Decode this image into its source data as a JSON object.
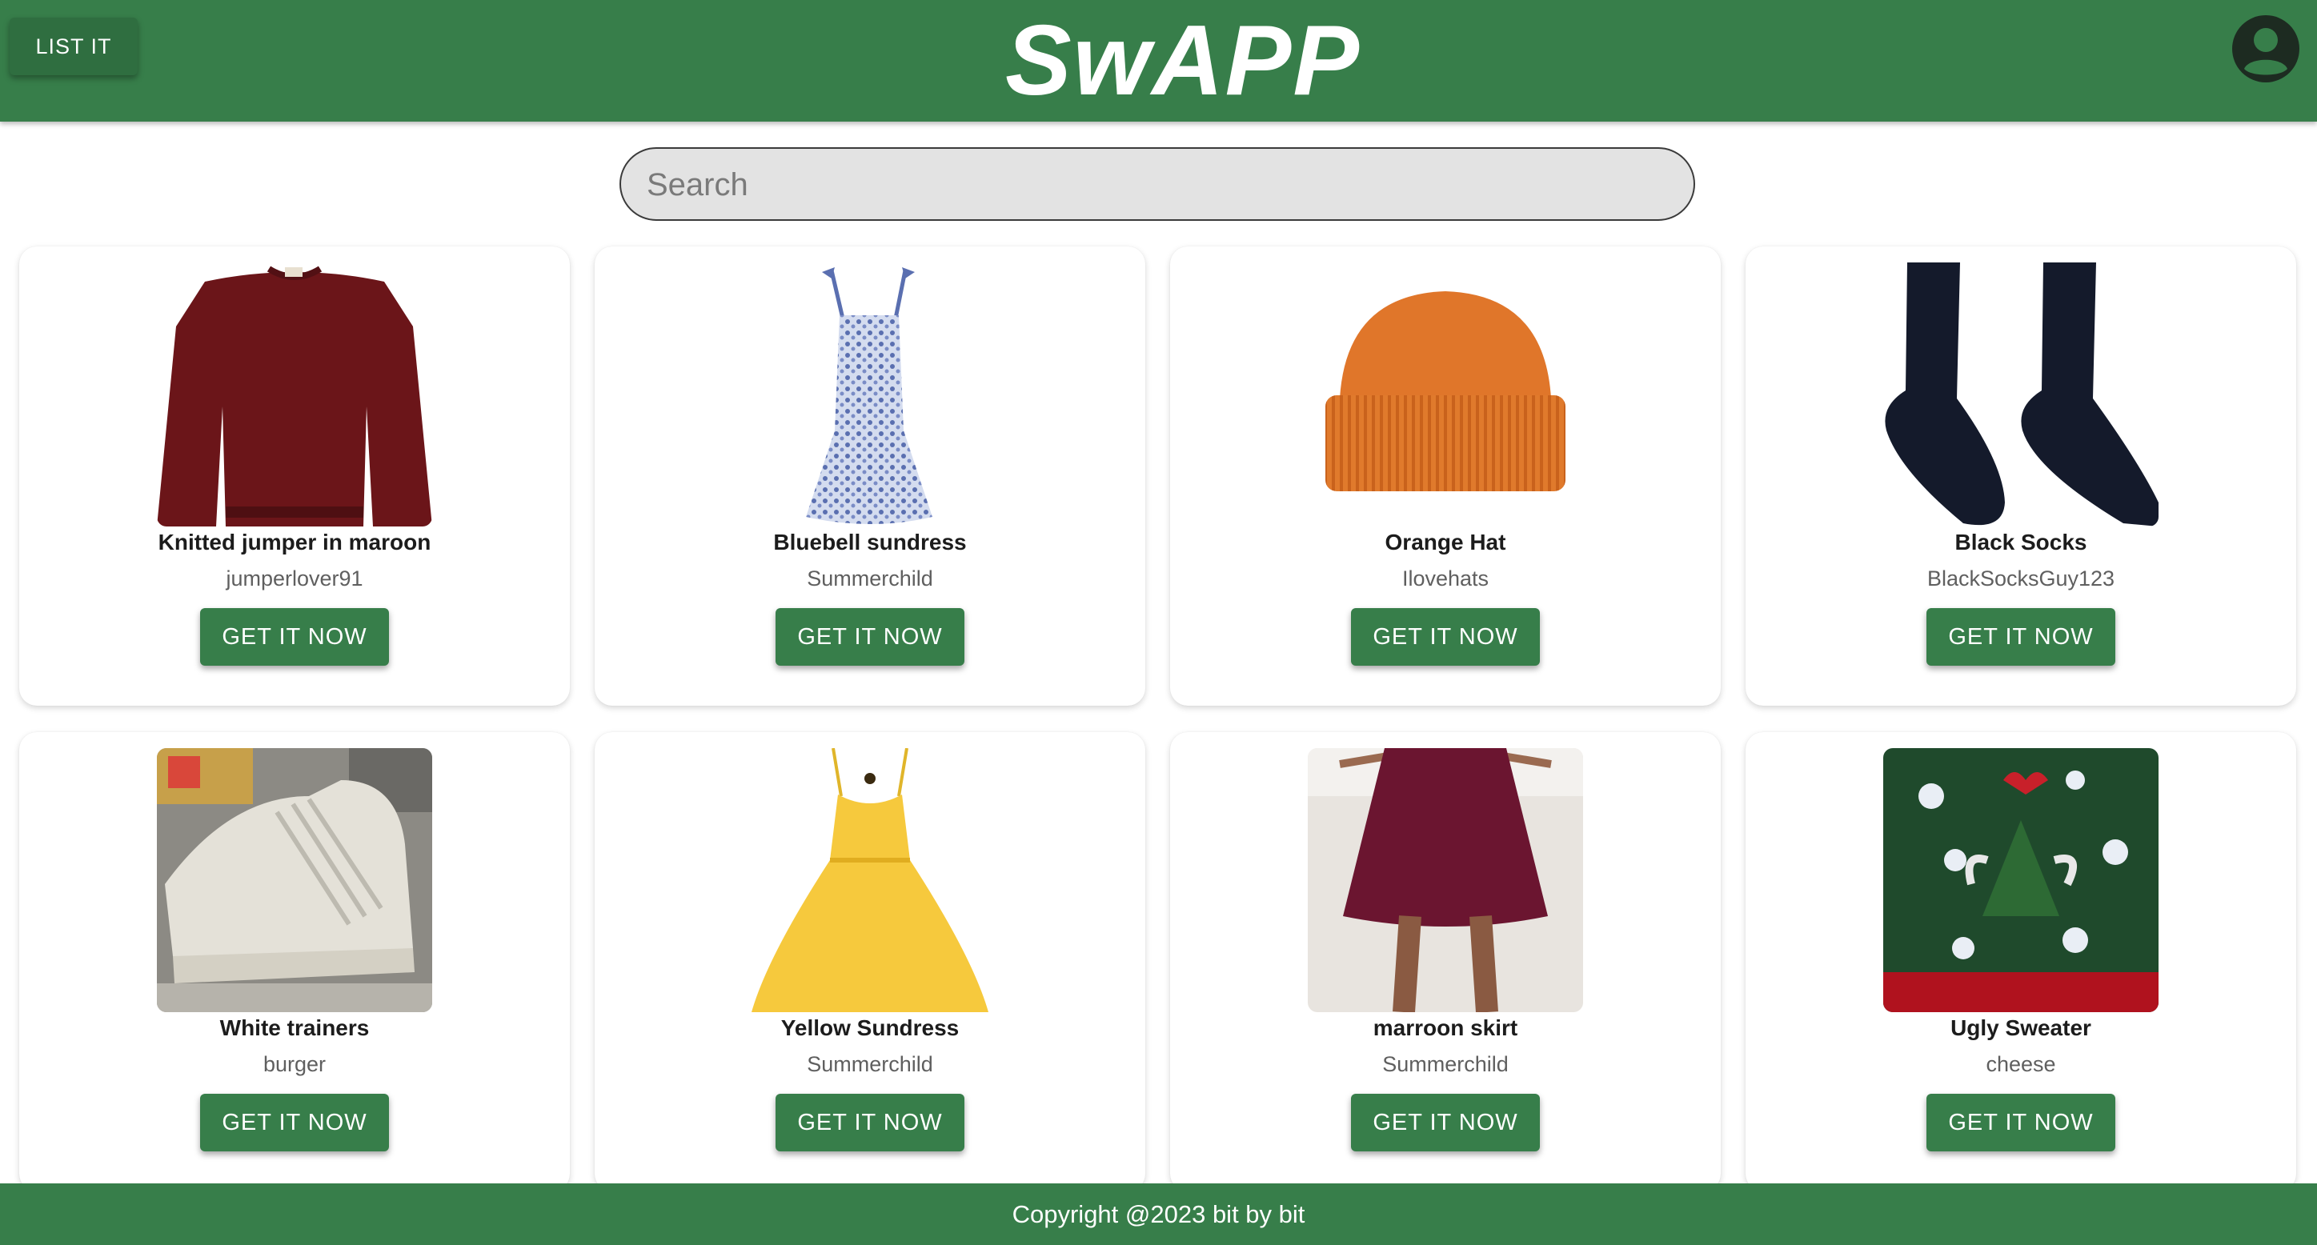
{
  "header": {
    "list_button": "LIST IT",
    "logo_text": "SwAPP",
    "profile_icon": "account-circle-icon"
  },
  "search": {
    "placeholder": "Search"
  },
  "listings": [
    {
      "title": "Knitted jumper in maroon",
      "seller": "jumperlover91",
      "button": "GET IT NOW",
      "image": "maroon-jumper"
    },
    {
      "title": "Bluebell sundress",
      "seller": "Summerchild",
      "button": "GET IT NOW",
      "image": "blue-floral-dress"
    },
    {
      "title": "Orange Hat",
      "seller": "Ilovehats",
      "button": "GET IT NOW",
      "image": "orange-beanie"
    },
    {
      "title": "Black Socks",
      "seller": "BlackSocksGuy123",
      "button": "GET IT NOW",
      "image": "black-socks"
    },
    {
      "title": "White trainers",
      "seller": "burger",
      "button": "GET IT NOW",
      "image": "white-trainers"
    },
    {
      "title": "Yellow Sundress",
      "seller": "Summerchild",
      "button": "GET IT NOW",
      "image": "yellow-dress"
    },
    {
      "title": "marroon skirt",
      "seller": "Summerchild",
      "button": "GET IT NOW",
      "image": "maroon-skirt"
    },
    {
      "title": "Ugly Sweater",
      "seller": "cheese",
      "button": "GET IT NOW",
      "image": "christmas-sweater"
    }
  ],
  "footer": {
    "text": "Copyright @2023 bit by bit"
  },
  "colors": {
    "primary": "#377e4a",
    "search_bg": "#e3e3e3"
  }
}
